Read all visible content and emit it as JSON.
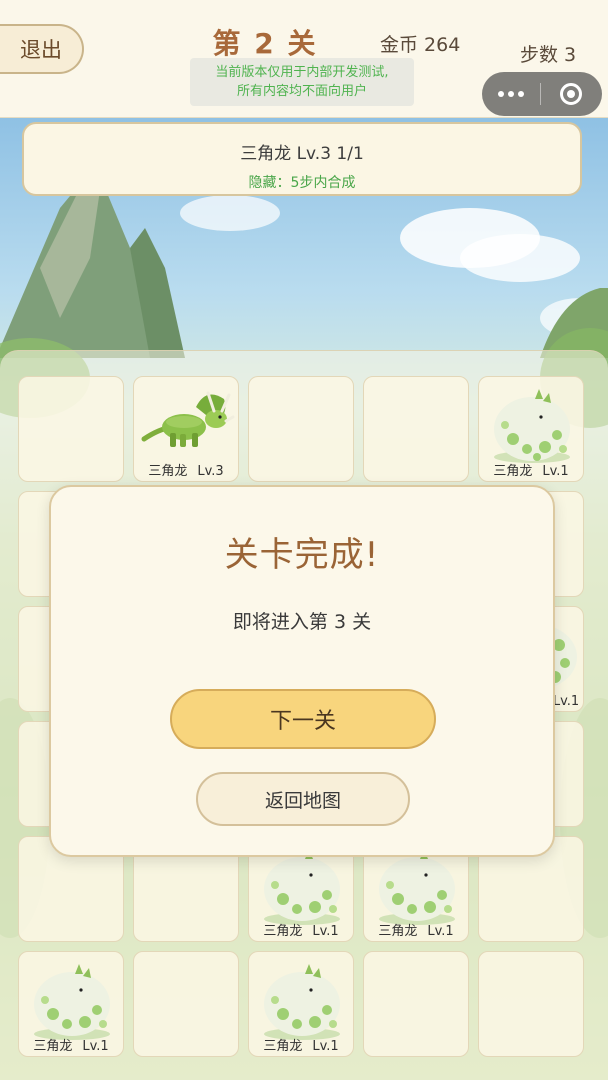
{
  "header": {
    "exit_label": "退出",
    "level_title": "第 2 关",
    "coins": "金币 264",
    "steps": "步数 3",
    "notice_line1": "当前版本仅用于内部开发测试,",
    "notice_line2": "所有内容均不面向用户"
  },
  "goal": {
    "main": "三角龙 Lv.3 1/1",
    "hidden": "隐藏：5步内合成"
  },
  "board": {
    "row0": [
      {
        "name": "",
        "level": ""
      },
      {
        "name": "三角龙",
        "level": "Lv.3"
      },
      {
        "name": "",
        "level": ""
      },
      {
        "name": "",
        "level": ""
      },
      {
        "name": "三角龙",
        "level": "Lv.1"
      }
    ],
    "row2_partial_level": "Lv.1",
    "row4": [
      {
        "name": "",
        "level": ""
      },
      {
        "name": "",
        "level": ""
      },
      {
        "name": "三角龙",
        "level": "Lv.1"
      },
      {
        "name": "三角龙",
        "level": "Lv.1"
      },
      {
        "name": "",
        "level": ""
      }
    ],
    "row5": [
      {
        "name": "三角龙",
        "level": "Lv.1"
      },
      {
        "name": "",
        "level": ""
      },
      {
        "name": "三角龙",
        "level": "Lv.1"
      },
      {
        "name": "",
        "level": ""
      },
      {
        "name": "",
        "level": ""
      }
    ]
  },
  "modal": {
    "title": "关卡完成!",
    "subtitle": "即将进入第 3 关",
    "next_label": "下一关",
    "map_label": "返回地图"
  },
  "colors": {
    "title_brown": "#a8693a",
    "notice_green": "#4fb34f",
    "next_button": "#f8d57d"
  }
}
